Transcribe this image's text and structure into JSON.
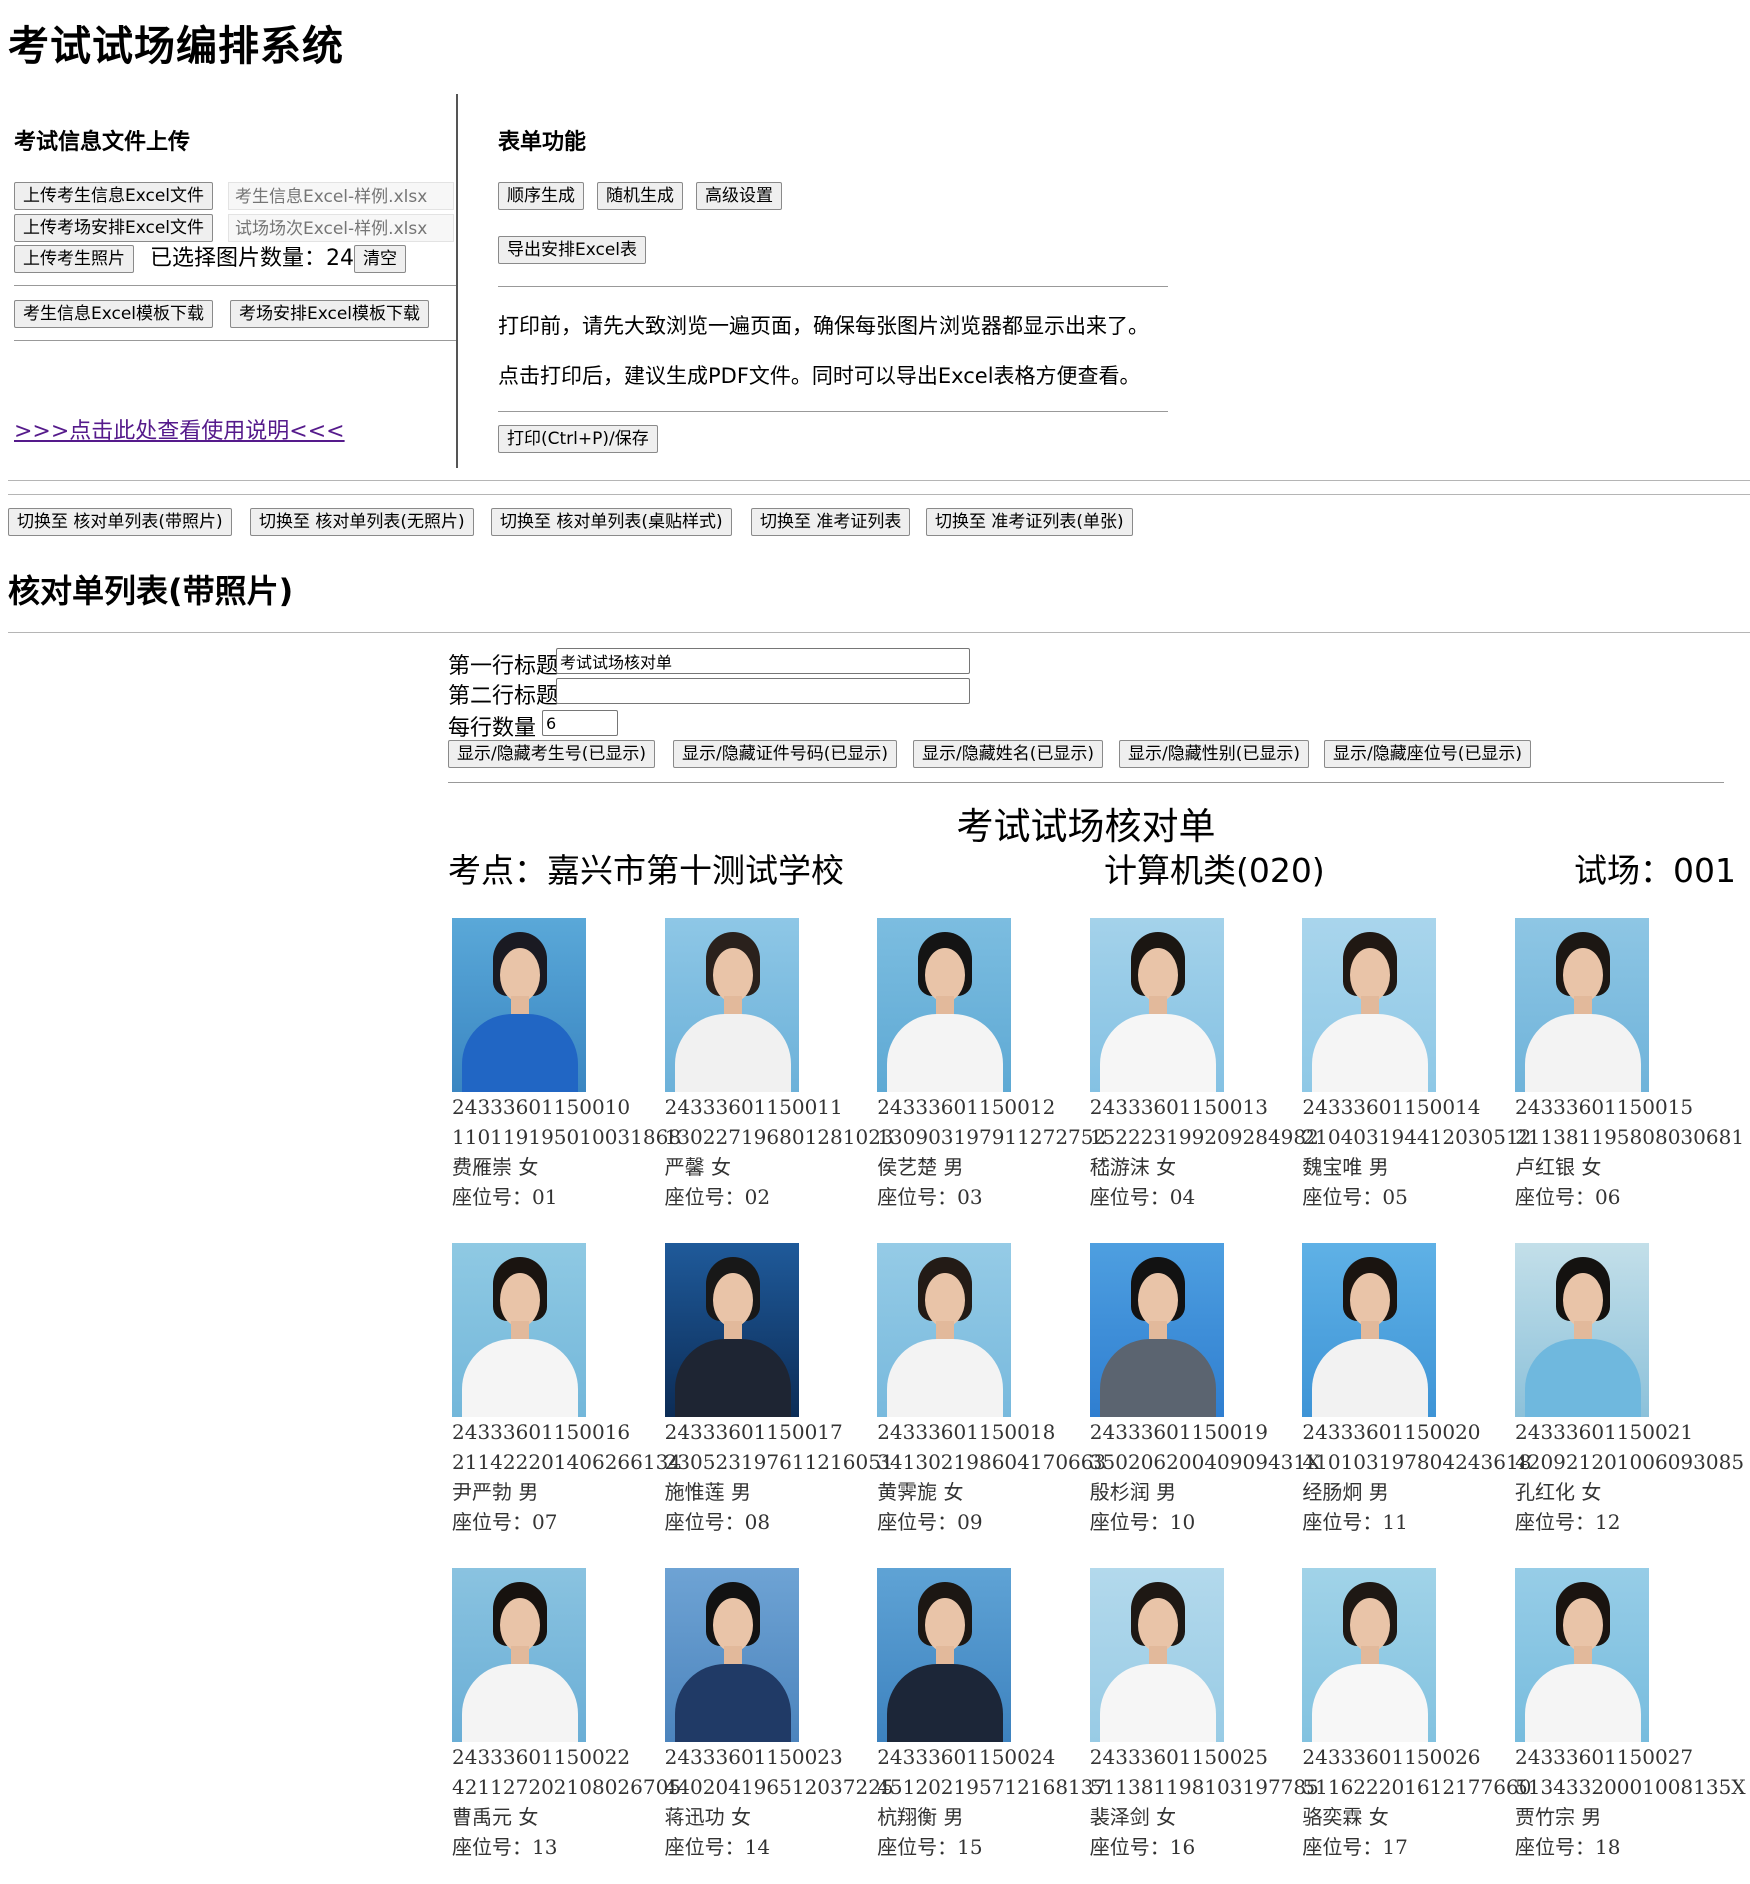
{
  "app_title": "考试试场编排系统",
  "upload": {
    "title": "考试信息文件上传",
    "student_excel_button": "上传考生信息Excel文件",
    "student_excel_file": "考生信息Excel-样例.xlsx",
    "room_excel_button": "上传考场安排Excel文件",
    "room_excel_file": "试场场次Excel-样例.xlsx",
    "photo_button": "上传考生照片",
    "photo_count_label": "已选择图片数量：",
    "photo_count": "24",
    "clear_button": "清空",
    "student_template_button": "考生信息Excel模板下载",
    "room_template_button": "考场安排Excel模板下载",
    "help_link": ">>>点击此处查看使用说明<<<"
  },
  "forms": {
    "title": "表单功能",
    "sequential_button": "顺序生成",
    "random_button": "随机生成",
    "advanced_button": "高级设置",
    "export_button": "导出安排Excel表",
    "note1": "打印前，请先大致浏览一遍页面，确保每张图片浏览器都显示出来了。",
    "note2": "点击打印后，建议生成PDF文件。同时可以导出Excel表格方便查看。",
    "print_button": "打印(Ctrl+P)/保存"
  },
  "view_switch": [
    "切换至 核对单列表(带照片)",
    "切换至 核对单列表(无照片)",
    "切换至 核对单列表(桌贴样式)",
    "切换至 准考证列表",
    "切换至 准考证列表(单张)"
  ],
  "list_title": "核对单列表(带照片)",
  "settings": {
    "row1_label": "第一行标题",
    "row1_value": "考试试场核对单",
    "row2_label": "第二行标题",
    "row2_value": "",
    "per_row_label": "每行数量",
    "per_row_value": "6",
    "toggles": [
      "显示/隐藏考生号(已显示)",
      "显示/隐藏证件号码(已显示)",
      "显示/隐藏姓名(已显示)",
      "显示/隐藏性别(已显示)",
      "显示/隐藏座位号(已显示)"
    ]
  },
  "sheet": {
    "title": "考试试场核对单",
    "site": "考点：嘉兴市第十测试学校",
    "category": "计算机类(020)",
    "room": "试场：001"
  },
  "students": [
    {
      "exam_no": "24333601150010",
      "id_no": "110119195010031868",
      "name_gender": "费雁崇 女",
      "seat": "座位号：01",
      "bg1": "#5aa8d8",
      "bg2": "#3a86c2",
      "hair": "#1a1a22",
      "shirt": "#2166c4"
    },
    {
      "exam_no": "24333601150011",
      "id_no": "130227196801281023",
      "name_gender": "严馨 女",
      "seat": "座位号：02",
      "bg1": "#8ec7e6",
      "bg2": "#6cb1d9",
      "hair": "#2a211c",
      "shirt": "#f1f1f1"
    },
    {
      "exam_no": "24333601150012",
      "id_no": "130903197911272752",
      "name_gender": "侯艺楚 男",
      "seat": "座位号：03",
      "bg1": "#7cbde0",
      "bg2": "#5ea9d4",
      "hair": "#141414",
      "shirt": "#f4f4f4"
    },
    {
      "exam_no": "24333601150013",
      "id_no": "152223199209284982",
      "name_gender": "嵇游沫 女",
      "seat": "座位号：04",
      "bg1": "#a4d2ea",
      "bg2": "#84c1e3",
      "hair": "#1b1612",
      "shirt": "#f6f6f6"
    },
    {
      "exam_no": "24333601150014",
      "id_no": "210403194412030512",
      "name_gender": "魏宝唯 男",
      "seat": "座位号：05",
      "bg1": "#a9d5ec",
      "bg2": "#8ec8e6",
      "hair": "#201813",
      "shirt": "#f5f5f5"
    },
    {
      "exam_no": "24333601150015",
      "id_no": "211381195808030681",
      "name_gender": "卢红银 女",
      "seat": "座位号：06",
      "bg1": "#8ec6e4",
      "bg2": "#6fb3da",
      "hair": "#1c1713",
      "shirt": "#f3f3f3"
    },
    {
      "exam_no": "24333601150016",
      "id_no": "211422201406266134",
      "name_gender": "尹严勃 男",
      "seat": "座位号：07",
      "bg1": "#8fc9e3",
      "bg2": "#73b7da",
      "hair": "#1a1410",
      "shirt": "#f5f5f5"
    },
    {
      "exam_no": "24333601150017",
      "id_no": "230523197611216051",
      "name_gender": "施惟莲 男",
      "seat": "座位号：08",
      "bg1": "#1f5a9a",
      "bg2": "#0c2c56",
      "hair": "#181818",
      "shirt": "#1e2533"
    },
    {
      "exam_no": "24333601150018",
      "id_no": "341302198604170663",
      "name_gender": "黄霁旎 女",
      "seat": "座位号：09",
      "bg1": "#95cbe6",
      "bg2": "#78b9dd",
      "hair": "#231b16",
      "shirt": "#f3f3f3"
    },
    {
      "exam_no": "24333601150019",
      "id_no": "35020620040909431X",
      "name_gender": "殷杉润 男",
      "seat": "座位号：10",
      "bg1": "#4e9fe0",
      "bg2": "#2f7ed0",
      "hair": "#121212",
      "shirt": "#5b6470"
    },
    {
      "exam_no": "24333601150020",
      "id_no": "410103197804243618",
      "name_gender": "经肠炯 男",
      "seat": "座位号：11",
      "bg1": "#5fb1e6",
      "bg2": "#3e94d6",
      "hair": "#1a1410",
      "shirt": "#f2f2f2"
    },
    {
      "exam_no": "24333601150021",
      "id_no": "420921201006093085",
      "name_gender": "孔红化 女",
      "seat": "座位号：12",
      "bg1": "#c3dfe9",
      "bg2": "#8cc1da",
      "hair": "#141210",
      "shirt": "#6fb8de"
    },
    {
      "exam_no": "24333601150022",
      "id_no": "421127202108026705",
      "name_gender": "曹禹元 女",
      "seat": "座位号：13",
      "bg1": "#8ac3e0",
      "bg2": "#6aaed6",
      "hair": "#17120f",
      "shirt": "#f4f4f4"
    },
    {
      "exam_no": "24333601150023",
      "id_no": "440204196512037225",
      "name_gender": "蒋迅功 女",
      "seat": "座位号：14",
      "bg1": "#6ea3d4",
      "bg2": "#4c84bd",
      "hair": "#121212",
      "shirt": "#203a66"
    },
    {
      "exam_no": "24333601150024",
      "id_no": "451202195712168137",
      "name_gender": "杭翔衡 男",
      "seat": "座位号：15",
      "bg1": "#5fa3d5",
      "bg2": "#3d82bf",
      "hair": "#1c1713",
      "shirt": "#1c2638"
    },
    {
      "exam_no": "24333601150025",
      "id_no": "511381198103197785",
      "name_gender": "裴泽剑 女",
      "seat": "座位号：16",
      "bg1": "#b3d9ec",
      "bg2": "#98cbe5",
      "hair": "#1e1814",
      "shirt": "#f6f6f6"
    },
    {
      "exam_no": "24333601150026",
      "id_no": "511622201612177660",
      "name_gender": "骆奕霖 女",
      "seat": "座位号：17",
      "bg1": "#a1d3e8",
      "bg2": "#82c2e0",
      "hair": "#1e1814",
      "shirt": "#f7f7f7"
    },
    {
      "exam_no": "24333601150027",
      "id_no": "51343320001008135X",
      "name_gender": "贾竹宗 男",
      "seat": "座位号：18",
      "bg1": "#97cde7",
      "bg2": "#77bcde",
      "hair": "#1a1410",
      "shirt": "#f5f5f5"
    }
  ]
}
